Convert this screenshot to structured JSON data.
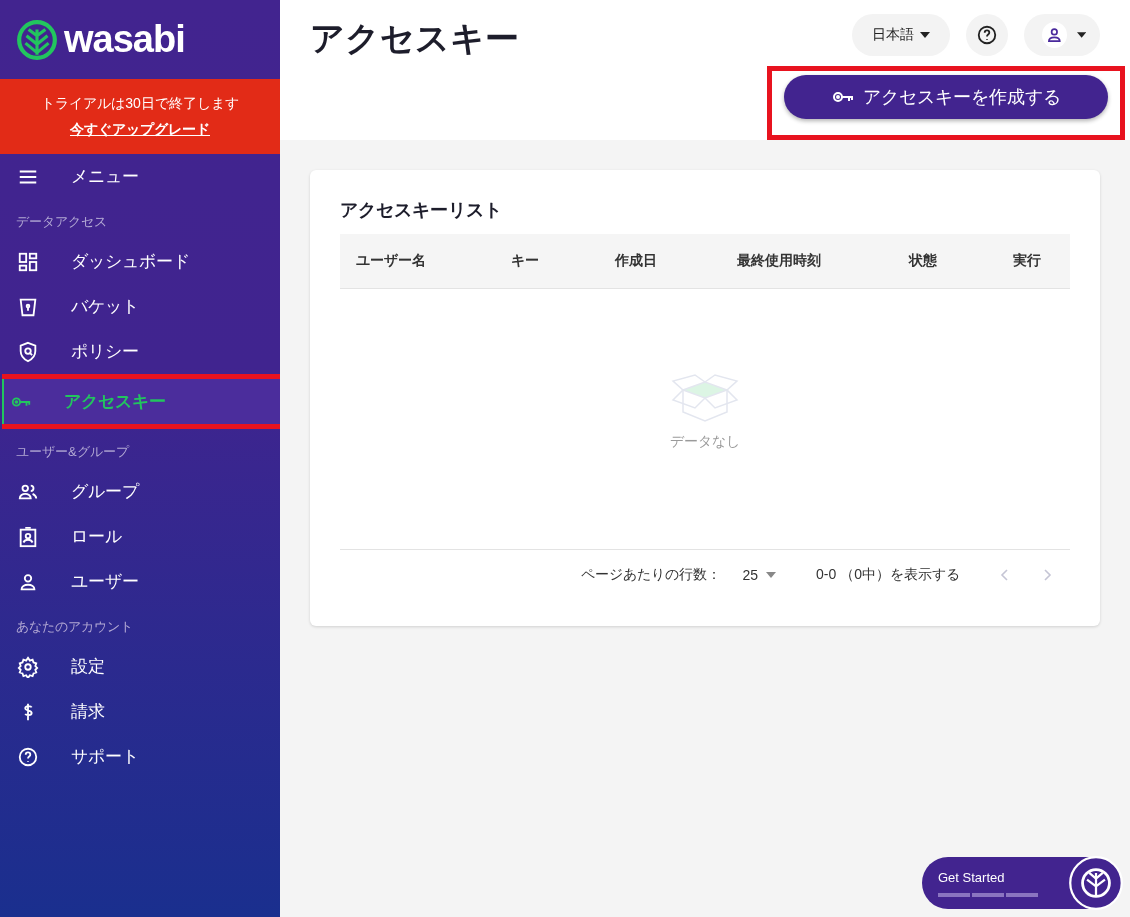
{
  "sidebar": {
    "logo": "wasabi",
    "trial_banner": {
      "message": "トライアルは30日で終了します",
      "link": "今すぐアップグレード"
    },
    "menu_toggle": "メニュー",
    "sections": [
      {
        "label": "データアクセス",
        "items": [
          {
            "label": "ダッシュボード",
            "selected": false,
            "highlighted": false
          },
          {
            "label": "バケット",
            "selected": false,
            "highlighted": false
          },
          {
            "label": "ポリシー",
            "selected": false,
            "highlighted": false
          },
          {
            "label": "アクセスキー",
            "selected": true,
            "highlighted": true
          }
        ]
      },
      {
        "label": "ユーザー&グループ",
        "items": [
          {
            "label": "グループ",
            "selected": false,
            "highlighted": false
          },
          {
            "label": "ロール",
            "selected": false,
            "highlighted": false
          },
          {
            "label": "ユーザー",
            "selected": false,
            "highlighted": false
          }
        ]
      },
      {
        "label": "あなたのアカウント",
        "items": [
          {
            "label": "設定",
            "selected": false,
            "highlighted": false
          },
          {
            "label": "請求",
            "selected": false,
            "highlighted": false
          },
          {
            "label": "サポート",
            "selected": false,
            "highlighted": false
          }
        ]
      }
    ]
  },
  "header": {
    "title": "アクセスキー",
    "language": "日本語",
    "create_button": {
      "label": "アクセスキーを作成する",
      "highlighted": true
    }
  },
  "card": {
    "title": "アクセスキーリスト",
    "table": {
      "columns": [
        "ユーザー名",
        "キー",
        "作成日",
        "最終使用時刻",
        "状態",
        "実行"
      ],
      "empty_text": "データなし"
    },
    "pagination": {
      "rows_per_page_label": "ページあたりの行数：",
      "rows_per_page": "25",
      "range": "0-0 （0中）を表示する"
    }
  },
  "get_started": {
    "label": "Get Started"
  }
}
